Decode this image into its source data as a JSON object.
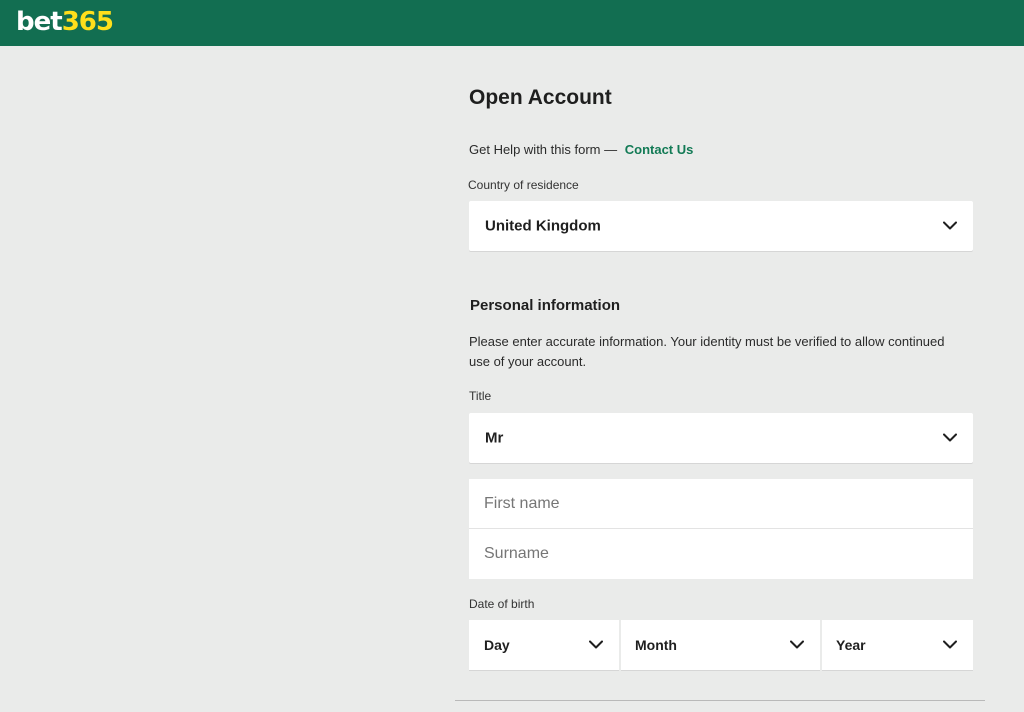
{
  "header": {
    "logo_bet": "bet",
    "logo_num": "365",
    "background": "#126e51",
    "logo_accent": "#ffdf1b"
  },
  "form": {
    "title": "Open Account",
    "help_text": "Get Help with this form —",
    "help_link": "Contact Us",
    "country_label": "Country of residence",
    "country_value": "United Kingdom",
    "personal_title": "Personal information",
    "personal_info": "Please enter accurate information. Your identity must be verified to allow continued use of your account.",
    "title_label": "Title",
    "title_value": "Mr",
    "first_name_placeholder": "First name",
    "surname_placeholder": "Surname",
    "dob_label": "Date of birth",
    "dob_day": "Day",
    "dob_month": "Month",
    "dob_year": "Year"
  },
  "icons": {
    "dropdown": "chevron-down-icon"
  }
}
